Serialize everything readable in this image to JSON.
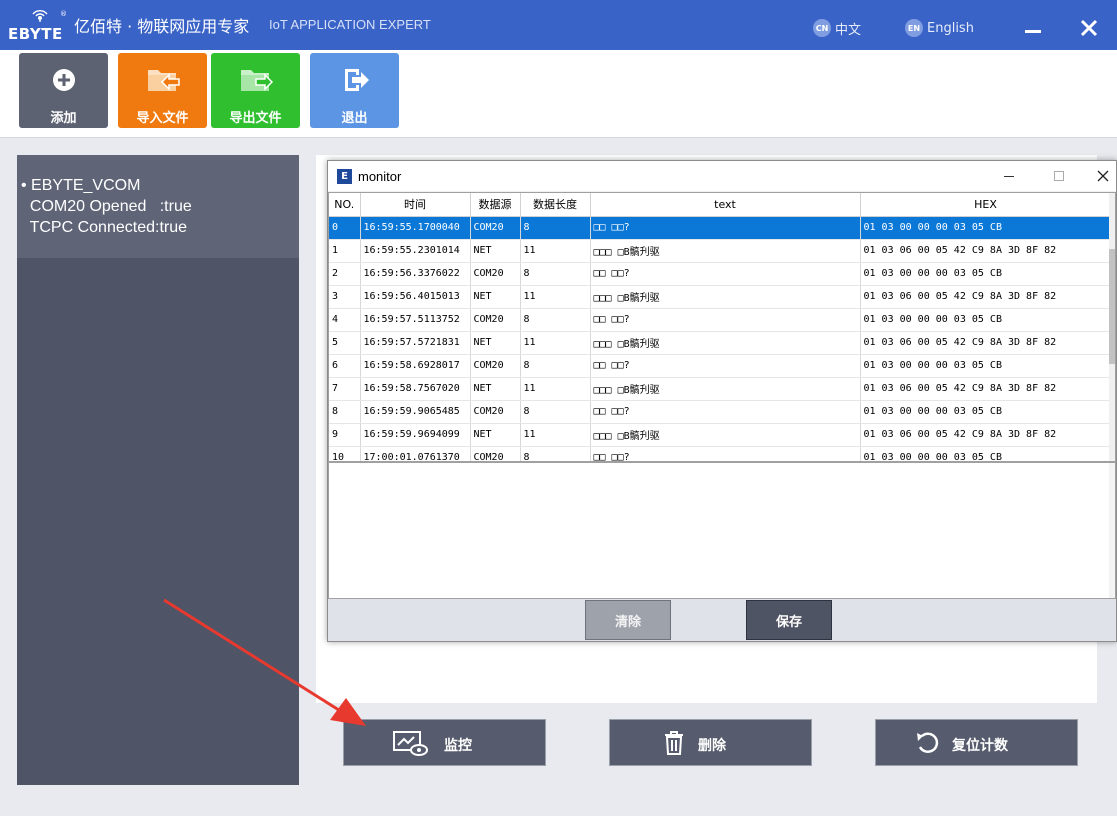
{
  "titlebar": {
    "logo_text": "EBYTE",
    "logo_reg": "®",
    "slogan": "亿佰特 · 物联网应用专家",
    "slogan_en": "IoT APPLICATION EXPERT",
    "lang_cn_badge": "CN",
    "lang_cn": "中文",
    "lang_en_badge": "EN",
    "lang_en": "English"
  },
  "toolbar": {
    "add_label": "添加",
    "import_label": "导入文件",
    "export_label": "导出文件",
    "exit_label": "退出"
  },
  "device": {
    "name": "• EBYTE_VCOM",
    "line1": "  COM20 Opened   :true",
    "line2": "  TCPC Connected:true"
  },
  "monitor": {
    "title": "monitor",
    "logo": "E",
    "columns": [
      "NO.",
      "时间",
      "数据源",
      "数据长度",
      "text",
      "HEX"
    ],
    "rows": [
      [
        "0",
        "16:59:55.1700040",
        "COM20",
        "8",
        "□□  □□?",
        "01 03 00 00 00 03 05 CB"
      ],
      [
        "1",
        "16:59:55.2301014",
        "NET",
        "11",
        "□□□ □B髇刋驱",
        "01 03 06 00 05 42 C9 8A 3D 8F 82"
      ],
      [
        "2",
        "16:59:56.3376022",
        "COM20",
        "8",
        "□□  □□?",
        "01 03 00 00 00 03 05 CB"
      ],
      [
        "3",
        "16:59:56.4015013",
        "NET",
        "11",
        "□□□ □B髇刋驱",
        "01 03 06 00 05 42 C9 8A 3D 8F 82"
      ],
      [
        "4",
        "16:59:57.5113752",
        "COM20",
        "8",
        "□□  □□?",
        "01 03 00 00 00 03 05 CB"
      ],
      [
        "5",
        "16:59:57.5721831",
        "NET",
        "11",
        "□□□ □B髇刋驱",
        "01 03 06 00 05 42 C9 8A 3D 8F 82"
      ],
      [
        "6",
        "16:59:58.6928017",
        "COM20",
        "8",
        "□□  □□?",
        "01 03 00 00 00 03 05 CB"
      ],
      [
        "7",
        "16:59:58.7567020",
        "NET",
        "11",
        "□□□ □B髇刋驱",
        "01 03 06 00 05 42 C9 8A 3D 8F 82"
      ],
      [
        "8",
        "16:59:59.9065485",
        "COM20",
        "8",
        "□□  □□?",
        "01 03 00 00 00 03 05 CB"
      ],
      [
        "9",
        "16:59:59.9694099",
        "NET",
        "11",
        "□□□ □B髇刋驱",
        "01 03 06 00 05 42 C9 8A 3D 8F 82"
      ],
      [
        "10",
        "17:00:01.0761370",
        "COM20",
        "8",
        "□□  □□?",
        "01 03 00 00 00 03 05 CB"
      ]
    ],
    "selected_row": 0,
    "clear_label": "清除",
    "save_label": "保存"
  },
  "actions": {
    "monitor_label": "监控",
    "delete_label": "删除",
    "reset_label": "复位计数"
  },
  "colors": {
    "titlebar": "#3a63c8",
    "add": "#5c6272",
    "import": "#f07a0f",
    "export": "#2fbf2f",
    "exit": "#5c95e3",
    "selection": "#0b78d7",
    "arrow": "#e8392f"
  },
  "icons": {
    "add": "plus-circle-icon",
    "import": "folder-import-icon",
    "export": "folder-export-icon",
    "exit": "exit-icon",
    "monitor": "monitor-eye-icon",
    "delete": "trash-icon",
    "reset": "reset-icon"
  }
}
